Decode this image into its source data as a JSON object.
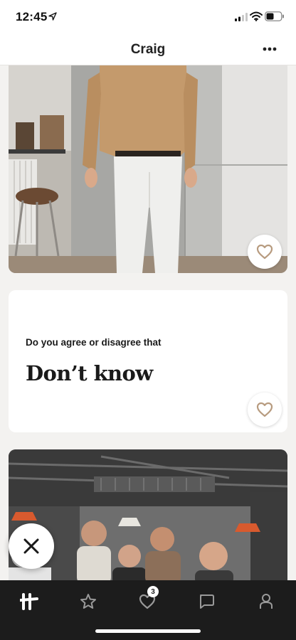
{
  "status_bar": {
    "time": "12:45"
  },
  "header": {
    "title": "Craig"
  },
  "prompt": {
    "question": "Do you agree or disagree that",
    "answer": "Don’t know"
  },
  "tab_bar": {
    "tabs": [
      {
        "name": "home",
        "icon": "hinge-logo-icon",
        "active": true
      },
      {
        "name": "standouts",
        "icon": "star-icon"
      },
      {
        "name": "likes-you",
        "icon": "heart-icon",
        "badge": "3"
      },
      {
        "name": "matches",
        "icon": "chat-bubble-icon"
      },
      {
        "name": "profile",
        "icon": "person-icon"
      }
    ]
  },
  "colors": {
    "background": "#f3f2f0",
    "tab_bar": "#1c1c1c",
    "like_icon": "#b79b7f"
  }
}
